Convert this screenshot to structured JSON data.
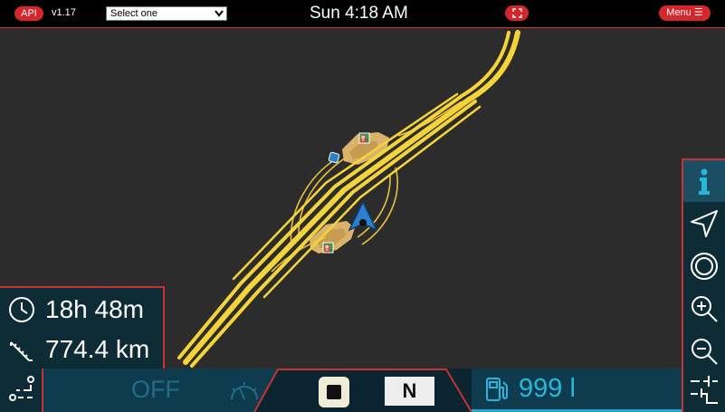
{
  "topbar": {
    "api_label": "API",
    "version": "v1.17",
    "select_value": "Select one",
    "clock": "Sun 4:18 AM",
    "menu_label": "Menu ☰"
  },
  "trip": {
    "time_remaining": "18h 48m",
    "distance": "774.4 km"
  },
  "cruise_control": {
    "status": "OFF"
  },
  "transmission": {
    "gear": "N"
  },
  "fuel": {
    "value": "999 l"
  },
  "colors": {
    "accent_red": "#d7262b",
    "panel_dark": "#0d2c36",
    "panel_mid": "#0e3b4d",
    "fuel_cyan": "#29b6dc",
    "road_yellow": "#f5d43a",
    "map_bg": "#2c2c2c"
  },
  "icons": {
    "time": "clock-icon",
    "distance": "ruler-icon",
    "route": "route-icon",
    "cruise": "speedometer-icon",
    "fuel": "fuel-pump-icon",
    "info": "info-icon",
    "navigate": "navigation-arrow-icon",
    "center": "center-target-icon",
    "zoom_in": "zoom-in-icon",
    "zoom_out": "zoom-out-icon",
    "layers": "dashed-layers-icon",
    "fullscreen": "fullscreen-icon"
  }
}
